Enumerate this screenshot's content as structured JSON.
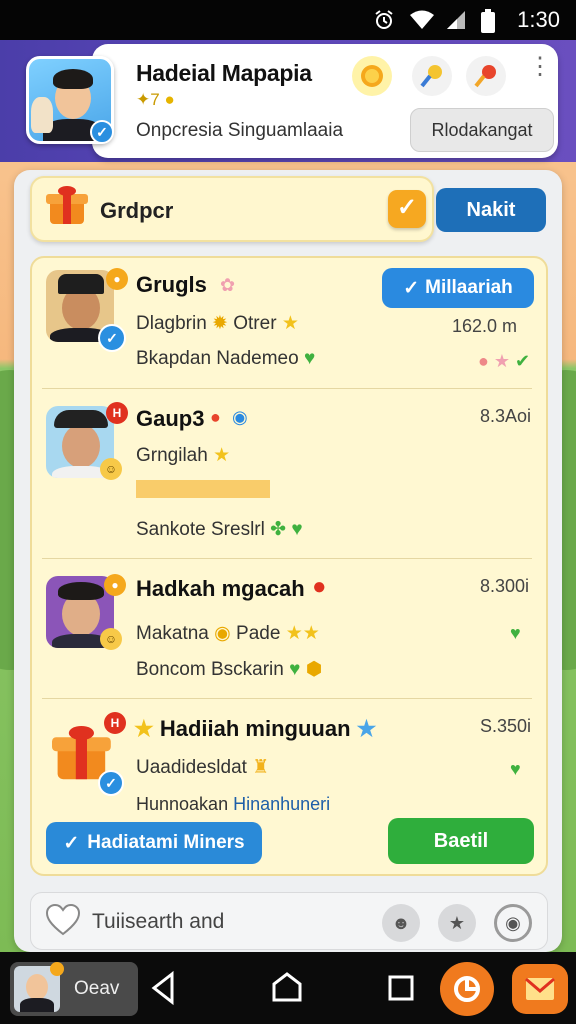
{
  "status_bar": {
    "time": "1:30",
    "icons": [
      "alarm-icon",
      "wifi-icon",
      "signal-icon",
      "battery-icon"
    ]
  },
  "header": {
    "title": "Hadeial Mapapia",
    "level": "7",
    "subtitle": "Onpcresia Singuamlaaia",
    "action_button": "Rlodakangat",
    "icons": [
      "coin-icon",
      "key-icon",
      "location-pin-icon",
      "more-vertical-icon"
    ]
  },
  "group_bar": {
    "label": "Grdpcr",
    "next_button": "Nakit"
  },
  "list": {
    "tag_button": "Millaariah",
    "items": [
      {
        "title": "Grugls",
        "line1": "Dlagbrin",
        "line1_extra": "Otrer",
        "line2": "Bkapdan Nademeo",
        "meta": "162.0 m"
      },
      {
        "title": "Gaup3",
        "line1": "Grngilah",
        "line2": "Sankote Sreslrl",
        "meta": "8.3Aoi",
        "progress_pct": 100
      },
      {
        "title": "Hadkah mgacah",
        "line1": "Makatna",
        "line1_extra": "Pade",
        "line2": "Boncom Bsckarin",
        "meta": "8.300i"
      },
      {
        "title": "Hadiiah minguuan",
        "line1": "Uaadidesldat",
        "line2_a": "Hunnoakan",
        "line2_b": "Hinanhuneri",
        "meta": "S.350i"
      }
    ],
    "bottom_left_button": "Hadiatami Miners",
    "send_button": "Baetil"
  },
  "search": {
    "placeholder": "Tuiisearth and"
  },
  "nav": {
    "app_label": "Oeav"
  },
  "colors": {
    "header_band": "#5a46b8",
    "accent_blue": "#2a8ae0",
    "accent_green": "#2fae3c",
    "card_bg": "#fff8d2"
  }
}
